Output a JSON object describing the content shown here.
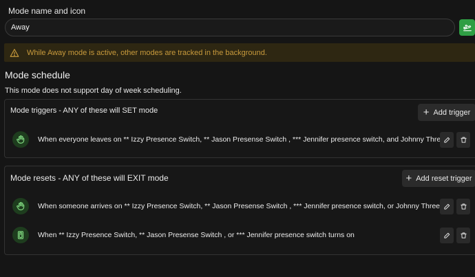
{
  "mode_name": {
    "label": "Mode name and icon",
    "value": "Away",
    "icon": "away-mode-icon",
    "accent": "#2f9e44"
  },
  "warning": {
    "icon": "warning-triangle-icon",
    "text": "While Away mode is active, other modes are tracked in the background.",
    "color": "#c89a3c"
  },
  "schedule": {
    "title": "Mode schedule",
    "note": "This mode does not support day of week scheduling."
  },
  "triggers": {
    "title": "Mode triggers - ANY of these will SET mode",
    "add_label": "Add trigger",
    "items": [
      {
        "icon": "hand-wave-icon",
        "text": "When everyone leaves on ** Izzy Presence Switch, ** Jason Presense Switch , *** Jennifer presence switch, and Johnny Three"
      }
    ]
  },
  "resets": {
    "title": "Mode resets - ANY of these will EXIT mode",
    "add_label": "Add reset trigger",
    "items": [
      {
        "icon": "hand-wave-icon",
        "text": "When someone arrives on ** Izzy Presence Switch, ** Jason Presense Switch , *** Jennifer presence switch, or Johnny Three"
      },
      {
        "icon": "switch-icon",
        "text": "When ** Izzy Presence Switch, ** Jason Presense Switch , or *** Jennifer presence switch turns on"
      }
    ]
  },
  "row_actions": {
    "edit_icon": "pencil-icon",
    "delete_icon": "trash-icon"
  }
}
